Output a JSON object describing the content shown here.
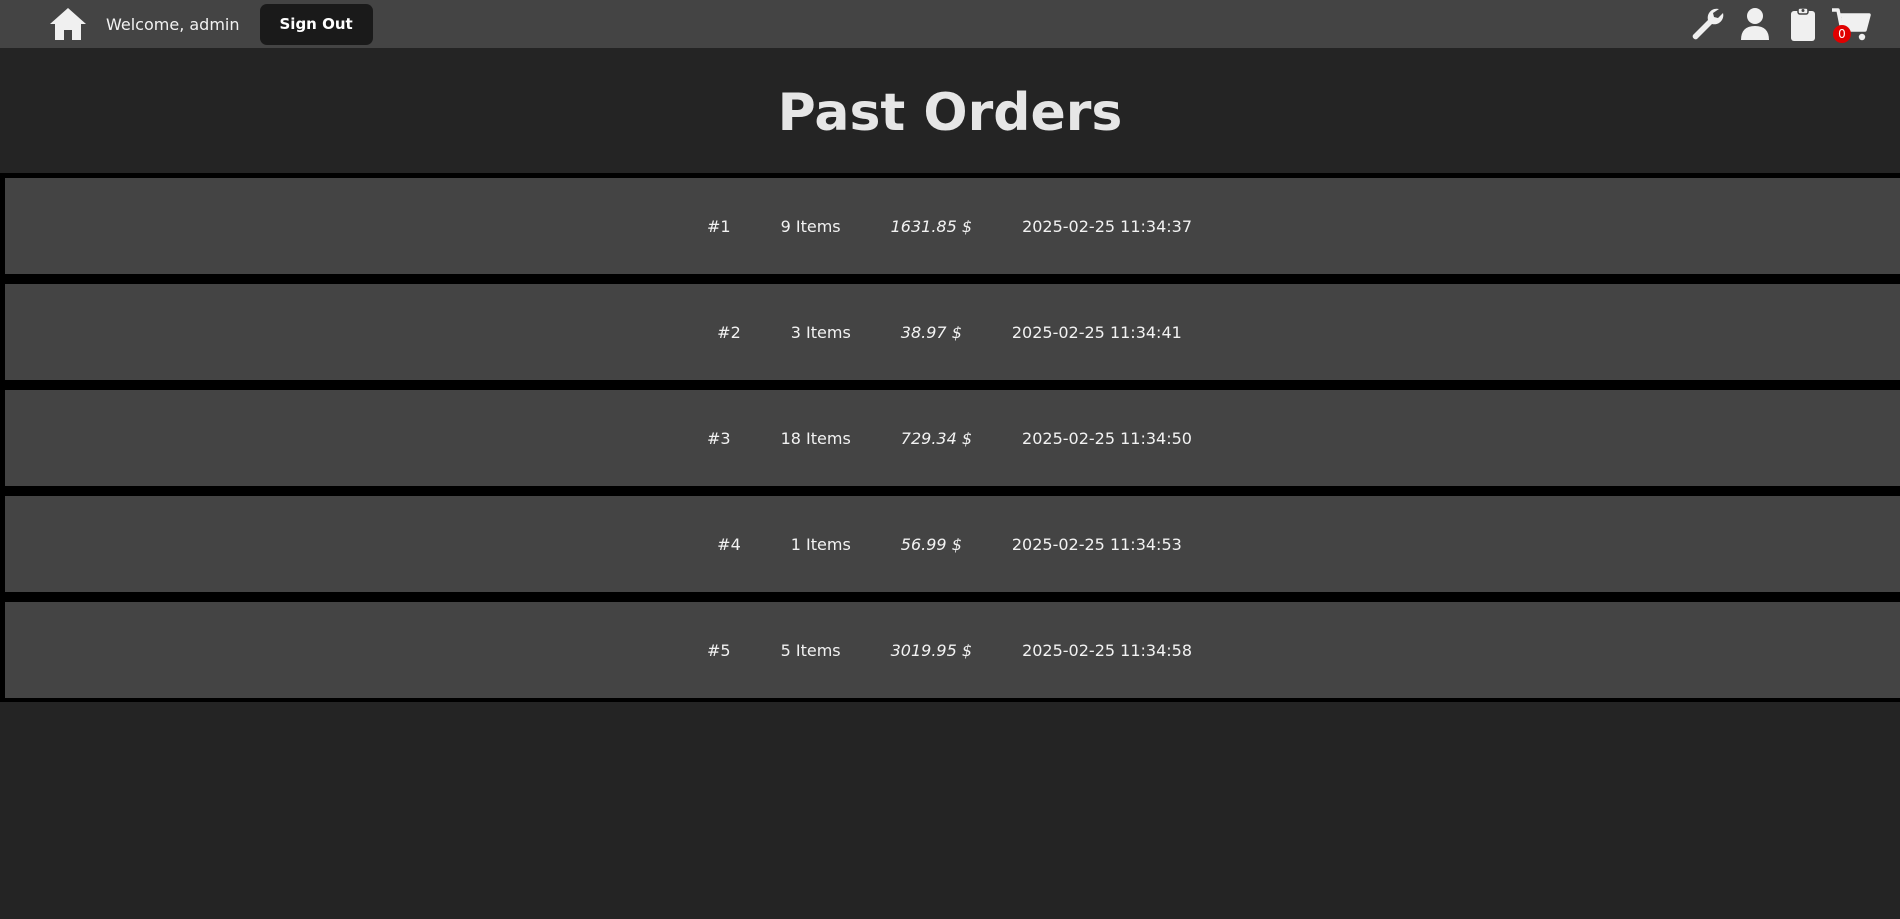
{
  "nav": {
    "welcome": "Welcome, admin",
    "sign_out": "Sign Out",
    "cart_count": "0",
    "icons": [
      "home-icon",
      "wrench-icon",
      "user-icon",
      "clipboard-icon",
      "cart-icon"
    ]
  },
  "page": {
    "title": "Past Orders"
  },
  "orders": [
    {
      "id": "#1",
      "items": "9 Items",
      "total": "1631.85 $",
      "date": "2025-02-25 11:34:37"
    },
    {
      "id": "#2",
      "items": "3 Items",
      "total": "38.97 $",
      "date": "2025-02-25 11:34:41"
    },
    {
      "id": "#3",
      "items": "18 Items",
      "total": "729.34 $",
      "date": "2025-02-25 11:34:50"
    },
    {
      "id": "#4",
      "items": "1 Items",
      "total": "56.99 $",
      "date": "2025-02-25 11:34:53"
    },
    {
      "id": "#5",
      "items": "5 Items",
      "total": "3019.95 $",
      "date": "2025-02-25 11:34:58"
    }
  ],
  "colors": {
    "background": "#242424",
    "navbar": "#444444",
    "row": "#444444",
    "badge": "#e00000"
  }
}
